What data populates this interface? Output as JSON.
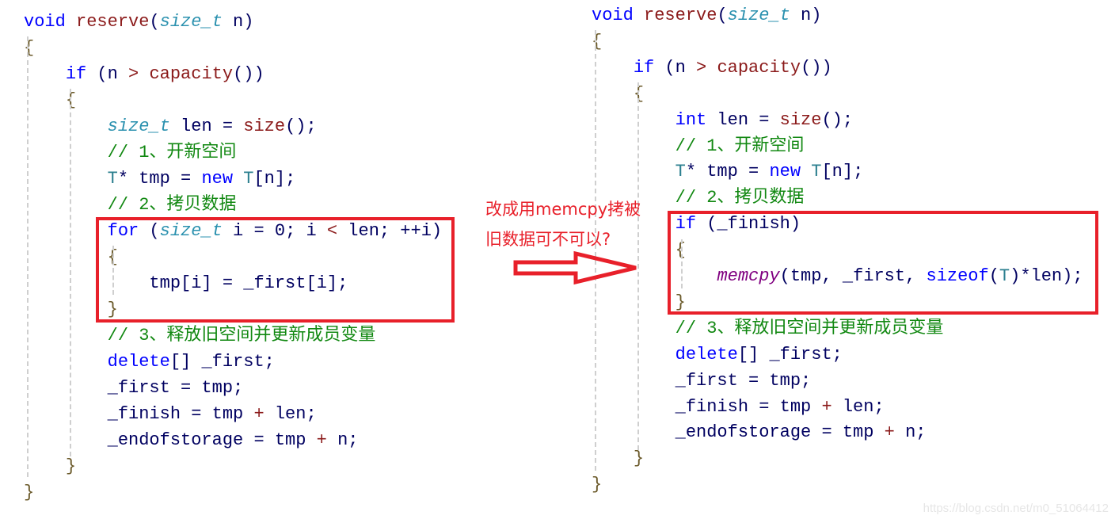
{
  "left_code": {
    "lines": [
      [
        [
          "void ",
          "kw"
        ],
        [
          "reserve",
          "fn"
        ],
        [
          "(",
          ""
        ],
        [
          "size_t",
          "ty"
        ],
        [
          " n)",
          ""
        ]
      ],
      [
        [
          "{",
          "br"
        ]
      ],
      [
        [
          "    ",
          ""
        ],
        [
          "if",
          "kw"
        ],
        [
          " (n ",
          ""
        ],
        [
          ">",
          "op"
        ],
        [
          " ",
          ""
        ],
        [
          "capacity",
          "fn"
        ],
        [
          "())",
          ""
        ]
      ],
      [
        [
          "    ",
          ""
        ],
        [
          "{",
          "br"
        ]
      ],
      [
        [
          "        ",
          ""
        ],
        [
          "size_t",
          "ty"
        ],
        [
          " len = ",
          ""
        ],
        [
          "size",
          "fn"
        ],
        [
          "();",
          ""
        ]
      ],
      [
        [
          "        ",
          ""
        ],
        [
          "// 1、开新空间",
          "cm"
        ]
      ],
      [
        [
          "        ",
          ""
        ],
        [
          "T",
          "tn"
        ],
        [
          "* tmp = ",
          ""
        ],
        [
          "new",
          "kw"
        ],
        [
          " ",
          ""
        ],
        [
          "T",
          "tn"
        ],
        [
          "[n];",
          ""
        ]
      ],
      [
        [
          "        ",
          ""
        ],
        [
          "// 2、拷贝数据",
          "cm"
        ]
      ],
      [
        [
          "        ",
          ""
        ],
        [
          "for",
          "kw"
        ],
        [
          " (",
          ""
        ],
        [
          "size_t",
          "ty"
        ],
        [
          " i = 0; i ",
          ""
        ],
        [
          "<",
          "op"
        ],
        [
          " len; ++i)",
          ""
        ]
      ],
      [
        [
          "        ",
          ""
        ],
        [
          "{",
          "br"
        ]
      ],
      [
        [
          "            tmp[i] = _first[i];",
          ""
        ]
      ],
      [
        [
          "        ",
          ""
        ],
        [
          "}",
          "br"
        ]
      ],
      [
        [
          "        ",
          ""
        ],
        [
          "// 3、释放旧空间并更新成员变量",
          "cm"
        ]
      ],
      [
        [
          "        ",
          ""
        ],
        [
          "delete",
          "kw"
        ],
        [
          "[] _first;",
          ""
        ]
      ],
      [
        [
          "        _first = tmp;",
          ""
        ]
      ],
      [
        [
          "        _finish = tmp ",
          ""
        ],
        [
          "+",
          "op"
        ],
        [
          " len;",
          ""
        ]
      ],
      [
        [
          "        _endofstorage = tmp ",
          ""
        ],
        [
          "+",
          "op"
        ],
        [
          " n;",
          ""
        ]
      ],
      [
        [
          "    ",
          ""
        ],
        [
          "}",
          "br"
        ]
      ],
      [
        [
          "}",
          "br"
        ]
      ]
    ]
  },
  "right_code": {
    "lines": [
      [
        [
          "void ",
          "kw"
        ],
        [
          "reserve",
          "fn"
        ],
        [
          "(",
          ""
        ],
        [
          "size_t",
          "ty"
        ],
        [
          " n)",
          ""
        ]
      ],
      [
        [
          "{",
          "br"
        ]
      ],
      [
        [
          "    ",
          ""
        ],
        [
          "if",
          "kw"
        ],
        [
          " (n ",
          ""
        ],
        [
          ">",
          "op"
        ],
        [
          " ",
          ""
        ],
        [
          "capacity",
          "fn"
        ],
        [
          "())",
          ""
        ]
      ],
      [
        [
          "    ",
          ""
        ],
        [
          "{",
          "br"
        ]
      ],
      [
        [
          "        ",
          ""
        ],
        [
          "int",
          "kw"
        ],
        [
          " len = ",
          ""
        ],
        [
          "size",
          "fn"
        ],
        [
          "();",
          ""
        ]
      ],
      [
        [
          "        ",
          ""
        ],
        [
          "// 1、开新空间",
          "cm"
        ]
      ],
      [
        [
          "        ",
          ""
        ],
        [
          "T",
          "tn"
        ],
        [
          "* tmp = ",
          ""
        ],
        [
          "new",
          "kw"
        ],
        [
          " ",
          ""
        ],
        [
          "T",
          "tn"
        ],
        [
          "[n];",
          ""
        ]
      ],
      [
        [
          "        ",
          ""
        ],
        [
          "// 2、拷贝数据",
          "cm"
        ]
      ],
      [
        [
          "        ",
          ""
        ],
        [
          "if",
          "kw"
        ],
        [
          " (_finish)",
          ""
        ]
      ],
      [
        [
          "        ",
          ""
        ],
        [
          "{",
          "br"
        ]
      ],
      [
        [
          "            ",
          ""
        ],
        [
          "memcpy",
          "mc"
        ],
        [
          "(tmp, _first, ",
          ""
        ],
        [
          "sizeof",
          "kw"
        ],
        [
          "(",
          ""
        ],
        [
          "T",
          "tn"
        ],
        [
          ")*len);",
          ""
        ]
      ],
      [
        [
          "        ",
          ""
        ],
        [
          "}",
          "br"
        ]
      ],
      [
        [
          "        ",
          ""
        ],
        [
          "// 3、释放旧空间并更新成员变量",
          "cm"
        ]
      ],
      [
        [
          "        ",
          ""
        ],
        [
          "delete",
          "kw"
        ],
        [
          "[] _first;",
          ""
        ]
      ],
      [
        [
          "        _first = tmp;",
          ""
        ]
      ],
      [
        [
          "        _finish = tmp ",
          ""
        ],
        [
          "+",
          "op"
        ],
        [
          " len;",
          ""
        ]
      ],
      [
        [
          "        _endofstorage = tmp ",
          ""
        ],
        [
          "+",
          "op"
        ],
        [
          " n;",
          ""
        ]
      ],
      [
        [
          "    ",
          ""
        ],
        [
          "}",
          "br"
        ]
      ],
      [
        [
          "}",
          "br"
        ]
      ]
    ]
  },
  "annotation": {
    "line1": "改成用memcpy拷被",
    "line2": "旧数据可不可以?"
  },
  "watermark": "https://blog.csdn.net/m0_51064412",
  "colors": {
    "highlight_box": "#e8202a",
    "keyword": "#0000ff",
    "comment": "#118811",
    "type": "#2b91af",
    "function": "#8b1a1a"
  }
}
